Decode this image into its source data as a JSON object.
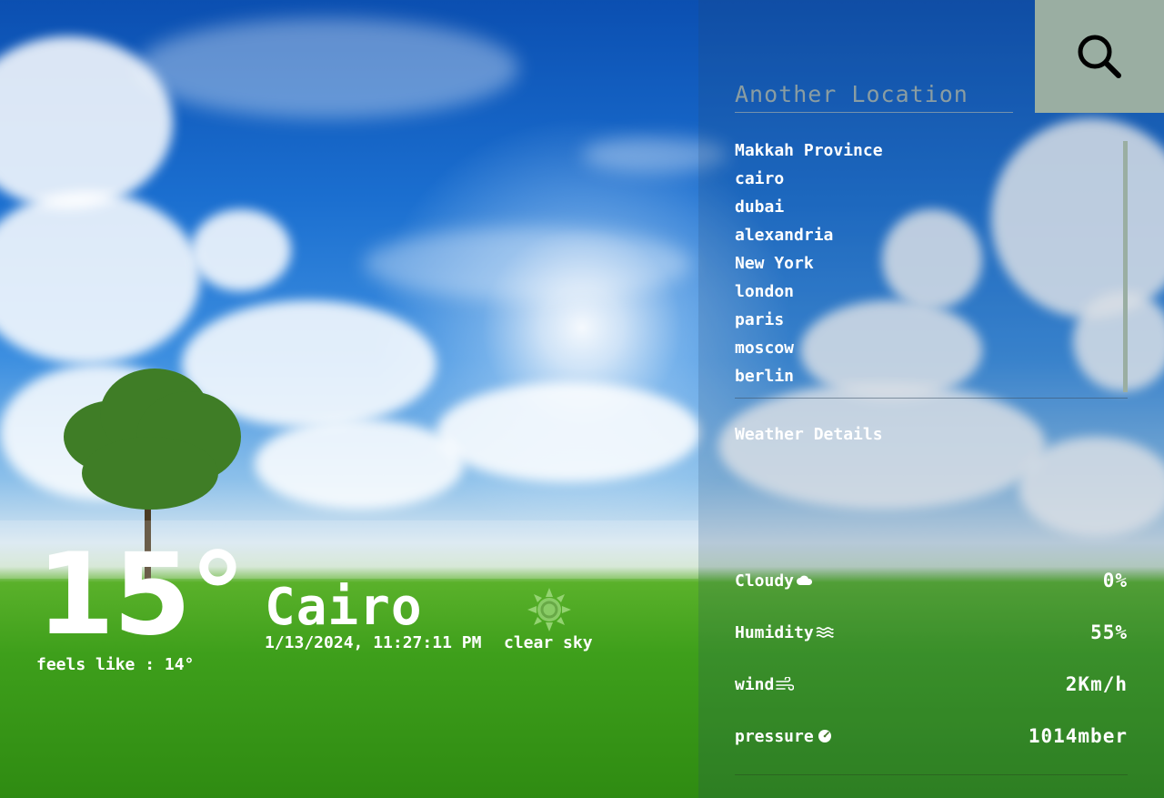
{
  "search": {
    "placeholder": "Another Location",
    "button_icon": "search-icon"
  },
  "cities": [
    "Makkah Province",
    "cairo",
    "dubai",
    "alexandria",
    "New York",
    "london",
    "paris",
    "moscow",
    "berlin"
  ],
  "details": {
    "title": "Weather Details",
    "rows": [
      {
        "label": "Cloudy",
        "icon": "cloud-icon",
        "value": "0%"
      },
      {
        "label": "Humidity",
        "icon": "water-icon",
        "value": "55%"
      },
      {
        "label": "wind",
        "icon": "wind-icon",
        "value": "2Km/h"
      },
      {
        "label": "pressure",
        "icon": "gauge-icon",
        "value": "1014mber"
      }
    ]
  },
  "current": {
    "temperature": "15°",
    "feels_like": "feels like : 14°",
    "city": "Cairo",
    "datetime": "1/13/2024, 11:27:11 PM",
    "condition": "clear sky",
    "condition_icon": "sun-icon"
  },
  "colors": {
    "search_button_bg": "#9aaea2",
    "text": "#ffffff"
  }
}
